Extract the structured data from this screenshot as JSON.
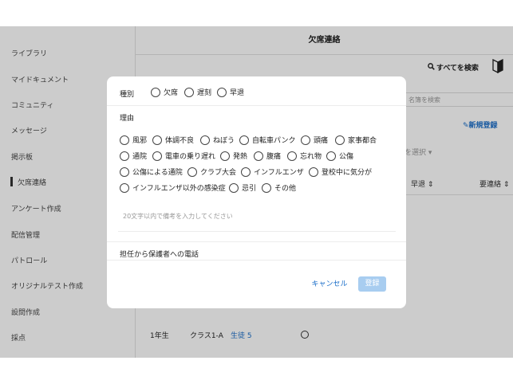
{
  "sidebar": {
    "items": [
      {
        "label": "ライブラリ"
      },
      {
        "label": "マイドキュメント"
      },
      {
        "label": "コミュニティ"
      },
      {
        "label": "メッセージ"
      },
      {
        "label": "掲示板"
      },
      {
        "label": "欠席連絡"
      },
      {
        "label": "アンケート作成"
      },
      {
        "label": "配信管理"
      },
      {
        "label": "パトロール"
      },
      {
        "label": "オリジナルテスト作成"
      },
      {
        "label": "設問作成"
      },
      {
        "label": "採点"
      }
    ]
  },
  "header": {
    "title": "欠席連絡",
    "search_all": "すべてを検索"
  },
  "toolbar": {
    "roster_placeholder": "名簿を検索",
    "new_registration": "新規登録",
    "select_placeholder": "を選択"
  },
  "table": {
    "columns": [
      "早退",
      "要連絡"
    ],
    "rows": [
      {
        "grade": "1年生",
        "class": "クラス1-A",
        "student": "生徒 5"
      }
    ]
  },
  "modal": {
    "type_label": "種別",
    "type_options": [
      "欠席",
      "遅刻",
      "早退"
    ],
    "reason_label": "理由",
    "reason_options": [
      [
        "風邪",
        "体調不良",
        "ねぼう",
        "自転車パンク",
        "頭痛",
        "家事都合"
      ],
      [
        "通院",
        "電車の乗り遅れ",
        "発熱",
        "腹痛",
        "忘れ物",
        "公傷"
      ],
      [
        "公傷による通院",
        "クラブ大会",
        "インフルエンザ",
        "登校中に気分が"
      ],
      [
        "インフルエンザ以外の感染症",
        "忌引",
        "その他"
      ]
    ],
    "note_placeholder": "20文字以内で備考を入力してください",
    "phone_label": "担任から保護者への電話",
    "cancel_label": "キャンセル",
    "register_label": "登録"
  }
}
